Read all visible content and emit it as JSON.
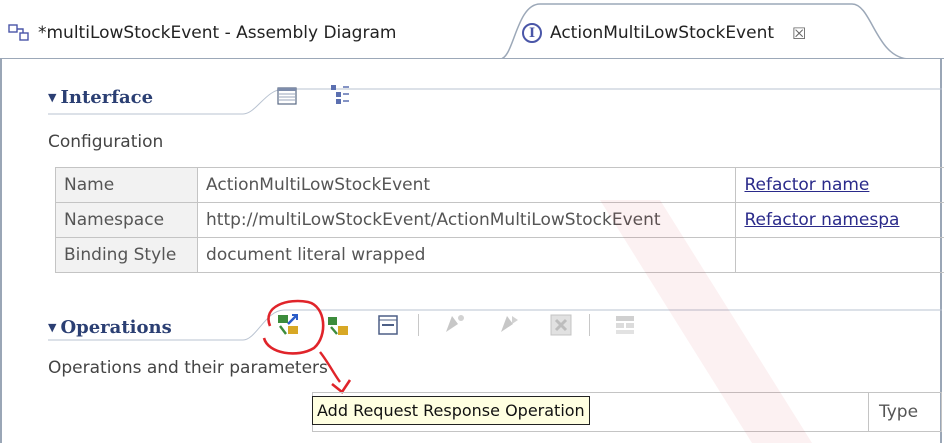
{
  "tabs": [
    {
      "label": "*multiLowStockEvent - Assembly Diagram",
      "icon": "assembly-diagram-icon"
    },
    {
      "label": "ActionMultiLowStockEvent",
      "icon": "interface-icon",
      "close": "☒"
    }
  ],
  "interface_section": {
    "title": "Interface",
    "description": "Configuration",
    "rows": [
      {
        "key": "Name",
        "value": "ActionMultiLowStockEvent",
        "action": "Refactor name"
      },
      {
        "key": "Namespace",
        "value": "http://multiLowStockEvent/ActionMultiLowStockEvent",
        "action": "Refactor namespa"
      },
      {
        "key": "Binding Style",
        "value": "document literal wrapped",
        "action": ""
      }
    ],
    "toolbar_icons": [
      "table-view-icon",
      "tree-view-icon"
    ]
  },
  "operations_section": {
    "title": "Operations",
    "description": "Operations and their parameters",
    "toolbar_icons": [
      "add-request-response-operation-icon",
      "add-one-way-operation-icon",
      "add-fault-icon",
      "add-input-icon",
      "add-output-icon",
      "delete-icon",
      "show-details-icon"
    ],
    "tooltip": "Add Request Response Operation",
    "table_header_type": "Type"
  },
  "colors": {
    "section_title": "#2b3f73",
    "highlight_circle": "#e0242a",
    "tooltip_bg": "#ffffe1",
    "watermark": "#c8141e"
  }
}
